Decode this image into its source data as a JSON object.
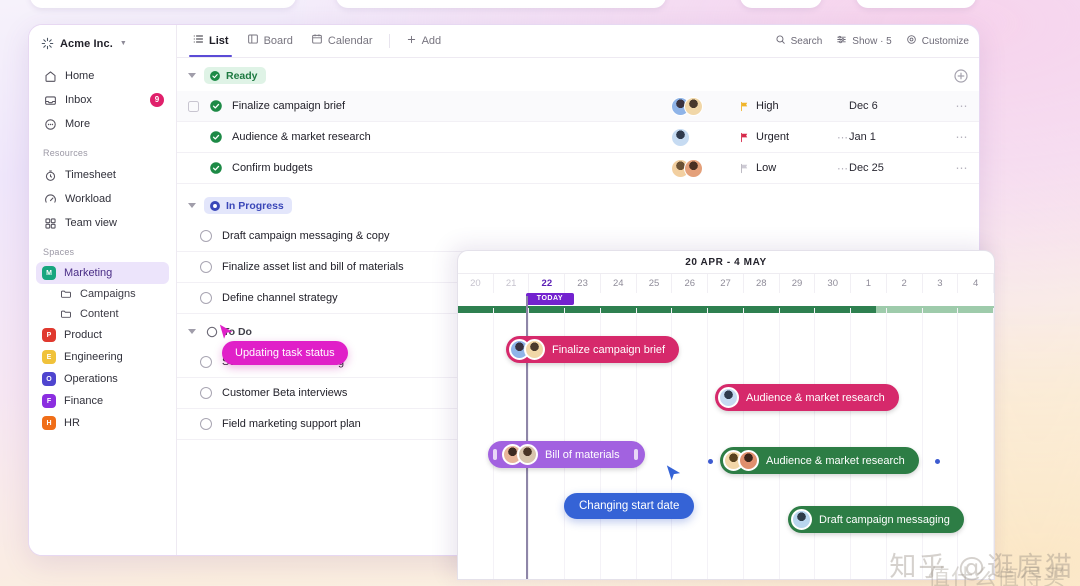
{
  "brand": {
    "name": "Acme Inc.",
    "caret": "chevron-down",
    "logo": "sparkle-icon"
  },
  "sidebar": {
    "nav": [
      {
        "label": "Home",
        "icon": "home-icon",
        "badge": ""
      },
      {
        "label": "Inbox",
        "icon": "inbox-icon",
        "badge": "9"
      },
      {
        "label": "More",
        "icon": "more-icon",
        "badge": ""
      }
    ],
    "resources_label": "Resources",
    "resources": [
      {
        "label": "Timesheet",
        "icon": "timer-icon"
      },
      {
        "label": "Workload",
        "icon": "gauge-icon"
      },
      {
        "label": "Team view",
        "icon": "grid-icon"
      }
    ],
    "spaces_label": "Spaces",
    "spaces": [
      {
        "label": "Marketing",
        "initial": "M",
        "color": "#18a67f",
        "active": true
      },
      {
        "label": "Product",
        "initial": "P",
        "color": "#e0392f",
        "active": false
      },
      {
        "label": "Engineering",
        "initial": "E",
        "color": "#f0c23a",
        "active": false
      },
      {
        "label": "Operations",
        "initial": "O",
        "color": "#4f45cf",
        "active": false
      },
      {
        "label": "Finance",
        "initial": "F",
        "color": "#8b2ee0",
        "active": false
      },
      {
        "label": "HR",
        "initial": "H",
        "color": "#f06e18",
        "active": false
      }
    ],
    "marketing_children": [
      {
        "label": "Campaigns",
        "icon": "folder-icon"
      },
      {
        "label": "Content",
        "icon": "folder-icon"
      }
    ]
  },
  "toolbar": {
    "tabs": [
      {
        "label": "List",
        "icon": "list-icon",
        "active": true
      },
      {
        "label": "Board",
        "icon": "board-icon",
        "active": false
      },
      {
        "label": "Calendar",
        "icon": "calendar-icon",
        "active": false
      }
    ],
    "add_label": "Add",
    "search_label": "Search",
    "show_label": "Show · 5",
    "customize_label": "Customize"
  },
  "groups": {
    "ready": {
      "label": "Ready",
      "icon": "check-circle-icon"
    },
    "in_progress": {
      "label": "In Progress",
      "icon": "progress-circle-icon"
    },
    "to_do": {
      "label": "To Do",
      "icon": "empty-circle-icon"
    }
  },
  "ready_rows": [
    {
      "name": "Finalize campaign brief",
      "priority": "High",
      "prio_color": "#f0b429",
      "date": "Dec 6",
      "more": "⋯",
      "dots": "",
      "avatars": [
        "#8fb4e8",
        "#f1d7a8"
      ],
      "selected": true
    },
    {
      "name": "Audience & market research",
      "priority": "Urgent",
      "prio_color": "#d6294a",
      "date": "Jan 1",
      "more": "⋯",
      "dots": "⋯",
      "avatars": [
        "#c6dbf2"
      ],
      "selected": false
    },
    {
      "name": "Confirm budgets",
      "priority": "Low",
      "prio_color": "#b6b3be",
      "date": "Dec 25",
      "more": "⋯",
      "dots": "⋯",
      "avatars": [
        "#f2cfa0",
        "#e4a07a"
      ],
      "selected": false
    }
  ],
  "progress_rows": [
    {
      "name": "Draft campaign messaging & copy"
    },
    {
      "name": "Finalize asset list and bill of materials"
    },
    {
      "name": "Define channel strategy"
    }
  ],
  "todo_rows": [
    {
      "name": "Schedule kickoff meeting"
    },
    {
      "name": "Customer Beta interviews"
    },
    {
      "name": "Field marketing support plan"
    }
  ],
  "tooltips": {
    "updating_status": "Updating task status",
    "changing_start": "Changing start date"
  },
  "gantt": {
    "title": "20 APR - 4 MAY",
    "today_label": "TODAY",
    "days": [
      {
        "n": "20",
        "state": "dim"
      },
      {
        "n": "21",
        "state": "dim"
      },
      {
        "n": "22",
        "state": "today"
      },
      {
        "n": "23",
        "state": "normal"
      },
      {
        "n": "24",
        "state": "normal"
      },
      {
        "n": "25",
        "state": "normal"
      },
      {
        "n": "26",
        "state": "normal"
      },
      {
        "n": "27",
        "state": "normal"
      },
      {
        "n": "28",
        "state": "normal"
      },
      {
        "n": "29",
        "state": "normal"
      },
      {
        "n": "30",
        "state": "normal"
      },
      {
        "n": "1",
        "state": "normal"
      },
      {
        "n": "2",
        "state": "normal"
      },
      {
        "n": "3",
        "state": "normal"
      },
      {
        "n": "4",
        "state": "normal"
      }
    ],
    "progress_percent": 78,
    "bars": [
      {
        "label": "Finalize campaign brief",
        "color": "pink",
        "avatars": [
          "#8fb4e8",
          "#f1d7a8"
        ],
        "handles": false
      },
      {
        "label": "Audience & market research",
        "color": "pink",
        "avatars": [
          "#c6dbf2"
        ],
        "handles": false
      },
      {
        "label": "Bill of materials",
        "color": "purple",
        "avatars": [
          "#e8b59a",
          "#d8c5ad"
        ],
        "handles": true
      },
      {
        "label": "Audience & market research",
        "color": "green",
        "avatars": [
          "#f2d6a8",
          "#e08f6e"
        ],
        "handles": false
      },
      {
        "label": "Draft campaign messaging",
        "color": "green",
        "avatars": [
          "#b9d6ef"
        ],
        "handles": false
      }
    ]
  },
  "watermark": {
    "line1": "知乎 @逛庹猫",
    "line2": "值什么值得买"
  }
}
